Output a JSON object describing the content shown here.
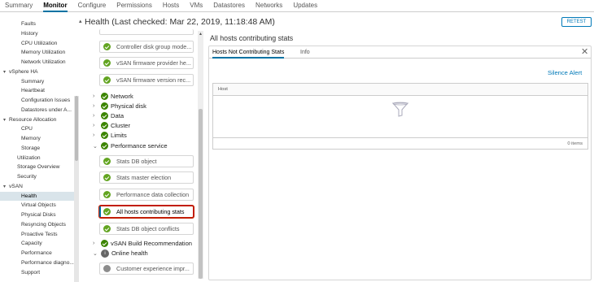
{
  "topnav": {
    "tabs": [
      "Summary",
      "Monitor",
      "Configure",
      "Permissions",
      "Hosts",
      "VMs",
      "Datastores",
      "Networks",
      "Updates"
    ],
    "active": "Monitor"
  },
  "sidebar": {
    "items": [
      {
        "label": "Faults",
        "indent": 2
      },
      {
        "label": "History",
        "indent": 2
      },
      {
        "label": "CPU Utilization",
        "indent": 2
      },
      {
        "label": "Memory Utilization",
        "indent": 2
      },
      {
        "label": "Network Utilization",
        "indent": 2
      },
      {
        "label": "vSphere HA",
        "indent": 0,
        "chevron": "▾"
      },
      {
        "label": "Summary",
        "indent": 2
      },
      {
        "label": "Heartbeat",
        "indent": 2
      },
      {
        "label": "Configuration Issues",
        "indent": 2
      },
      {
        "label": "Datastores under A...",
        "indent": 2
      },
      {
        "label": "Resource Allocation",
        "indent": 0,
        "chevron": "▾"
      },
      {
        "label": "CPU",
        "indent": 2
      },
      {
        "label": "Memory",
        "indent": 2
      },
      {
        "label": "Storage",
        "indent": 2
      },
      {
        "label": "Utilization",
        "indent": 1
      },
      {
        "label": "Storage Overview",
        "indent": 1
      },
      {
        "label": "Security",
        "indent": 1
      },
      {
        "label": "vSAN",
        "indent": 0,
        "chevron": "▾"
      },
      {
        "label": "Health",
        "indent": 2,
        "selected": true
      },
      {
        "label": "Virtual Objects",
        "indent": 2
      },
      {
        "label": "Physical Disks",
        "indent": 2
      },
      {
        "label": "Resyncing Objects",
        "indent": 2
      },
      {
        "label": "Proactive Tests",
        "indent": 2
      },
      {
        "label": "Capacity",
        "indent": 2
      },
      {
        "label": "Performance",
        "indent": 2
      },
      {
        "label": "Performance diagno...",
        "indent": 2
      },
      {
        "label": "Support",
        "indent": 2
      }
    ]
  },
  "health": {
    "title": "Health (Last checked: Mar 22, 2019, 11:18:48 AM)",
    "retest": "RETEST"
  },
  "tree": {
    "cards_top": [
      "Controller disk group mode...",
      "vSAN firmware provider he...",
      "vSAN firmware version rec..."
    ],
    "groups_mid": [
      "Network",
      "Physical disk",
      "Data",
      "Cluster",
      "Limits"
    ],
    "performance_group": "Performance service",
    "perf_cards": [
      "Stats DB object",
      "Stats master election",
      "Performance data collection",
      "All hosts contributing stats",
      "Stats DB object conflicts"
    ],
    "build_group": "vSAN Build Recommendation",
    "online_group": "Online health",
    "online_cards": [
      "Customer experience impr..."
    ]
  },
  "detail": {
    "title": "All hosts contributing stats",
    "tabs": [
      "Hosts Not Contributing Stats",
      "Info"
    ],
    "silence": "Silence Alert",
    "column": "Host",
    "footer": "0 items"
  },
  "colors": {
    "accent": "#0072a3",
    "ok": "#62a420",
    "selected_border": "#c21d00"
  }
}
